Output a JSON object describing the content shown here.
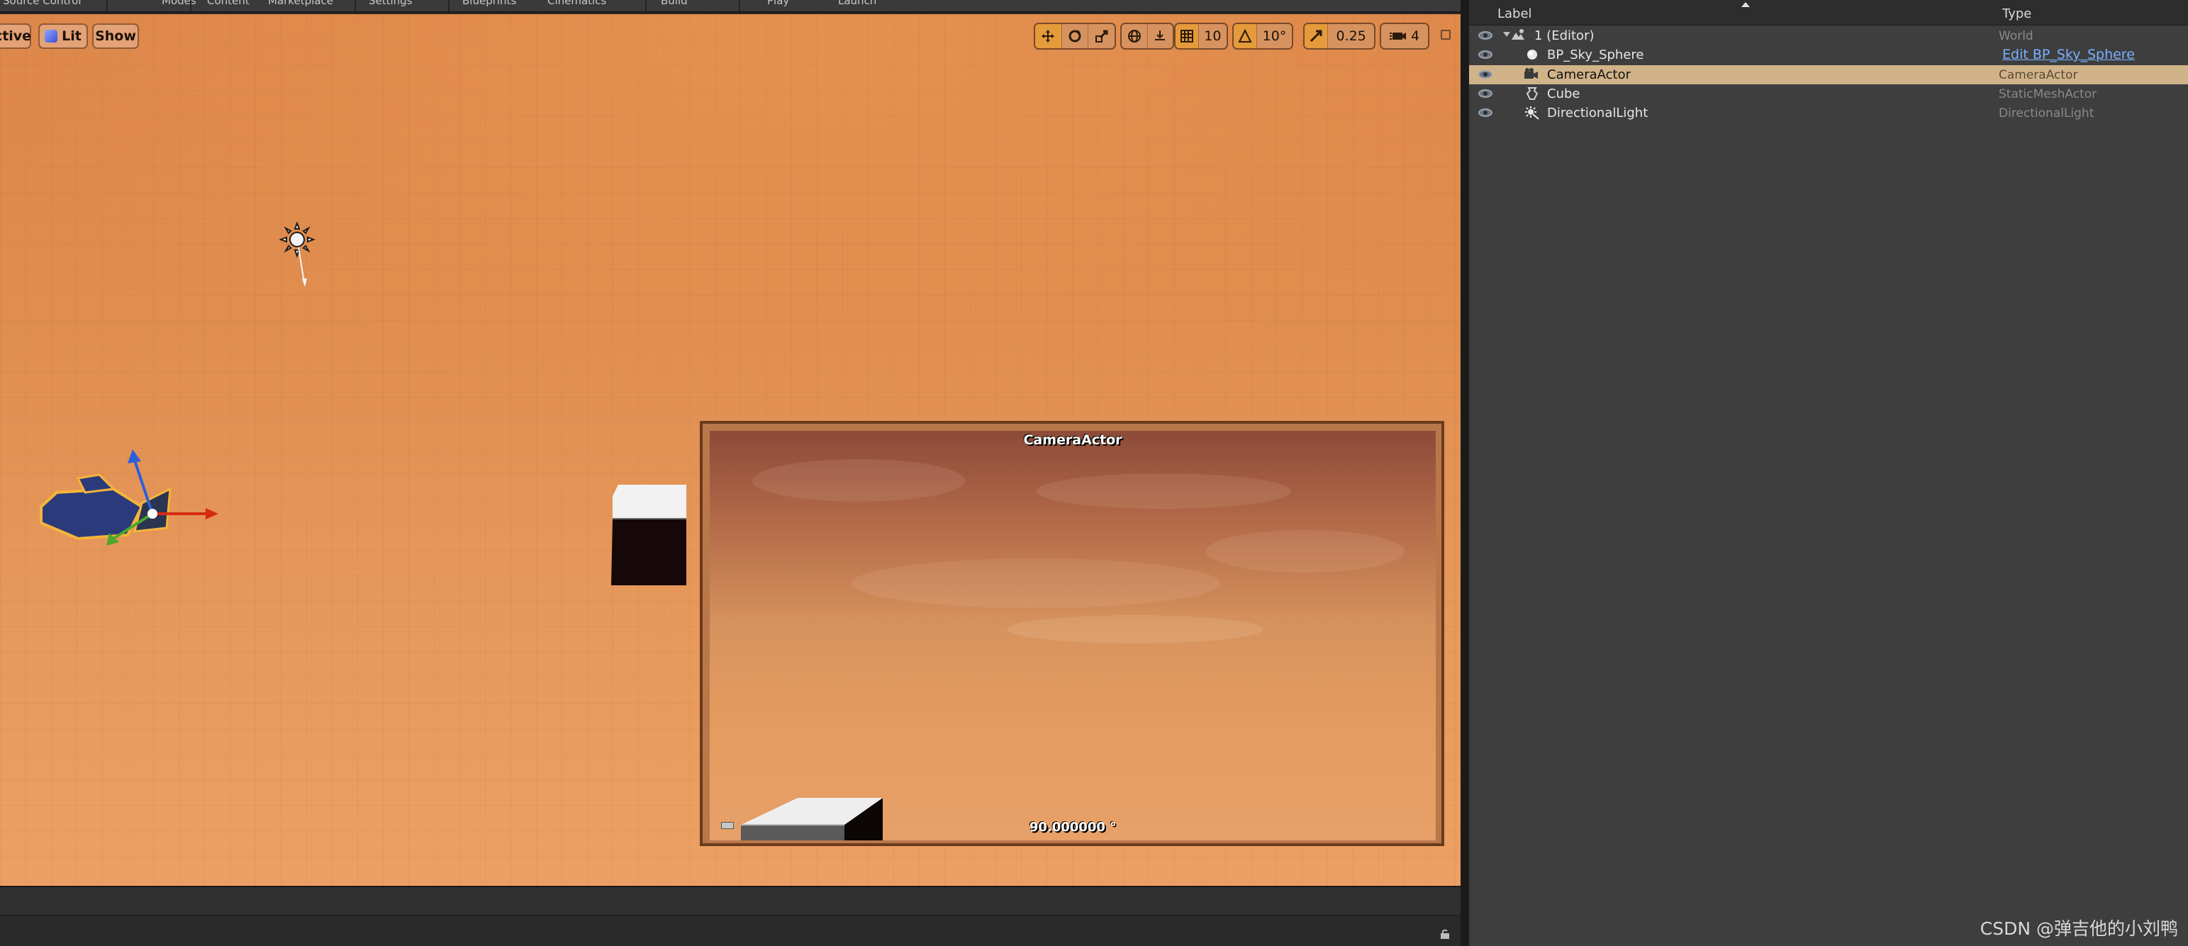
{
  "menubar": {
    "items": [
      "Source Control",
      "Modes",
      "Content",
      "Marketplace",
      "Settings",
      "Blueprints",
      "Cinematics",
      "Build",
      "Play",
      "Launch"
    ]
  },
  "viewport_toolbar": {
    "perspective_label": "ctive",
    "lit_label": "Lit",
    "show_label": "Show",
    "grid_snap_value": "10",
    "rotation_snap_value": "10°",
    "scale_snap_value": "0.25",
    "camera_speed_value": "4"
  },
  "camera_preview": {
    "title": "CameraActor",
    "fov_text": "90.000000 °"
  },
  "outliner": {
    "columns": {
      "label": "Label",
      "type": "Type"
    },
    "rows": [
      {
        "label": "1 (Editor)",
        "type": "World",
        "icon": "world-icon",
        "selected": false
      },
      {
        "label": "BP_Sky_Sphere",
        "type": "Edit BP_Sky_Sphere",
        "icon": "sphere-icon",
        "selected": false,
        "type_is_link": true
      },
      {
        "label": "CameraActor",
        "type": "CameraActor",
        "icon": "camera-icon",
        "selected": true
      },
      {
        "label": "Cube",
        "type": "StaticMeshActor",
        "icon": "static-mesh-icon",
        "selected": false
      },
      {
        "label": "DirectionalLight",
        "type": "DirectionalLight",
        "icon": "directional-light-icon",
        "selected": false
      }
    ]
  },
  "watermark": "CSDN @弹吉他的小刘鸭",
  "colors": {
    "viewport_orange": "#e08f52",
    "selection": "#d1b389",
    "link_blue": "#7bb0ff",
    "panel_bg": "#3e3e3e"
  }
}
